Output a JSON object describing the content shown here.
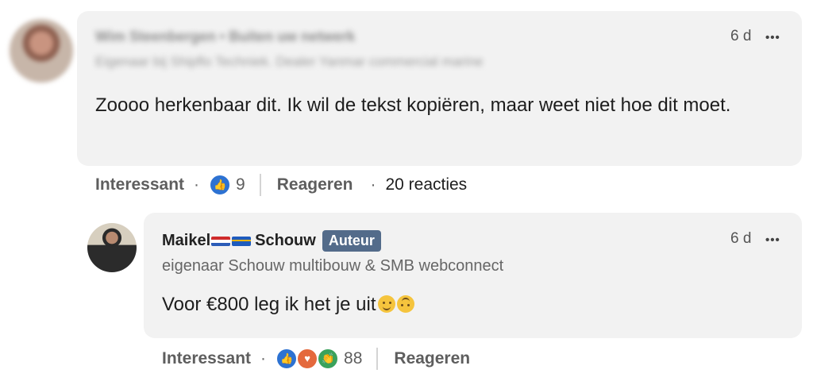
{
  "comment1": {
    "author_name": "Wim Steenbergen",
    "connection": "• Buiten uw netwerk",
    "headline": "Eigenaar bij Shipflo Techniek. Dealer Yanmar commercial marine",
    "time": "6 d",
    "more_label": "•••",
    "text": "Zoooo herkenbaar dit. Ik wil de tekst kopiëren, maar weet niet hoe dit moet.",
    "actions": {
      "interessant": "Interessant",
      "dot": "·",
      "like_count": "9",
      "reageren": "Reageren",
      "replies": "20 reacties"
    }
  },
  "comment2": {
    "author_first": "Maikel",
    "author_last": "Schouw",
    "badge": "Auteur",
    "headline": "eigenaar Schouw multibouw & SMB webconnect",
    "time": "6 d",
    "more_label": "•••",
    "text": "Voor €800 leg ik het je uit",
    "actions": {
      "interessant": "Interessant",
      "dot": "·",
      "reaction_count": "88",
      "reageren": "Reageren"
    }
  },
  "icons": {
    "like": "like-icon",
    "heart": "heart-icon",
    "clap": "clap-icon",
    "wink": "wink-emoji-icon",
    "upside": "upside-down-emoji-icon"
  },
  "colors": {
    "bubble": "#f2f2f2",
    "badge": "#536b8a",
    "like": "#2d72d2",
    "heart": "#e4693d",
    "clap": "#3aa25c"
  }
}
